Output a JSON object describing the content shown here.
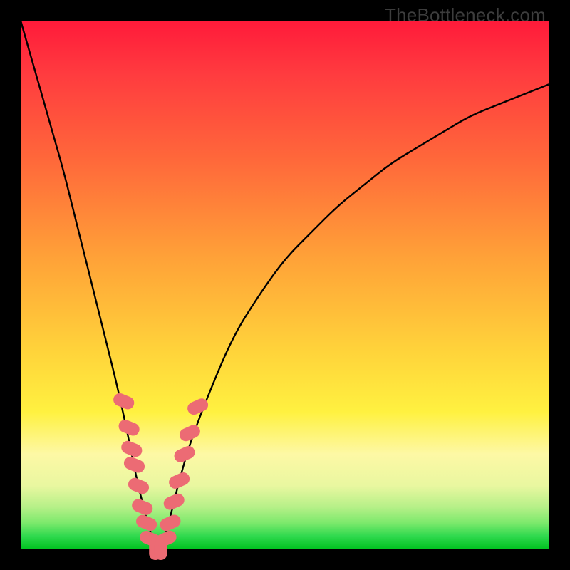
{
  "watermark": {
    "text": "TheBottleneck.com"
  },
  "chart_data": {
    "type": "line",
    "title": "",
    "xlabel": "",
    "ylabel": "",
    "xlim": [
      0,
      100
    ],
    "ylim": [
      0,
      100
    ],
    "series": [
      {
        "name": "bottleneck-curve",
        "x": [
          0,
          2,
          4,
          6,
          8,
          10,
          12,
          14,
          16,
          18,
          20,
          22,
          23,
          24,
          25,
          26,
          27,
          28,
          29,
          30,
          32,
          35,
          40,
          45,
          50,
          55,
          60,
          65,
          70,
          75,
          80,
          85,
          90,
          95,
          100
        ],
        "values": [
          100,
          93,
          86,
          79,
          72,
          64,
          56,
          48,
          40,
          32,
          23,
          13,
          9,
          5,
          2,
          0,
          2,
          5,
          9,
          13,
          20,
          28,
          40,
          48,
          55,
          60,
          65,
          69,
          73,
          76,
          79,
          82,
          84,
          86,
          88
        ]
      }
    ],
    "markers": {
      "name": "highlighted-points",
      "color": "#ec6b74",
      "points": [
        {
          "x": 19.5,
          "y": 28
        },
        {
          "x": 20.5,
          "y": 23
        },
        {
          "x": 21.0,
          "y": 19
        },
        {
          "x": 21.5,
          "y": 16
        },
        {
          "x": 22.3,
          "y": 12
        },
        {
          "x": 23.0,
          "y": 8
        },
        {
          "x": 23.8,
          "y": 5
        },
        {
          "x": 24.5,
          "y": 2
        },
        {
          "x": 25.5,
          "y": 0
        },
        {
          "x": 26.5,
          "y": 0
        },
        {
          "x": 27.5,
          "y": 2
        },
        {
          "x": 28.3,
          "y": 5
        },
        {
          "x": 29.0,
          "y": 9
        },
        {
          "x": 30.0,
          "y": 13
        },
        {
          "x": 31.0,
          "y": 18
        },
        {
          "x": 32.0,
          "y": 22
        },
        {
          "x": 33.5,
          "y": 27
        }
      ]
    },
    "background_gradient": {
      "top": "#ff1a3a",
      "upper_mid": "#ffa238",
      "mid": "#fff140",
      "lower": "#7ce96c",
      "bottom": "#00c21f"
    }
  }
}
